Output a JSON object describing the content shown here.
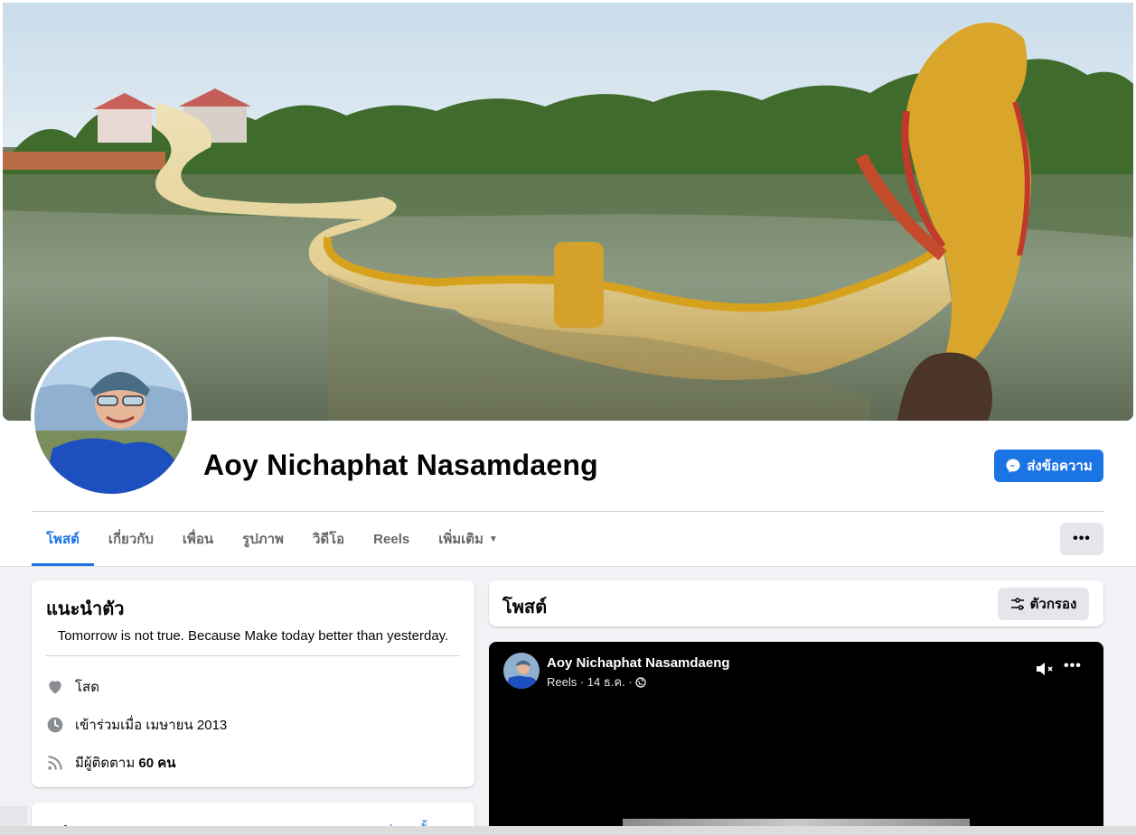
{
  "profile": {
    "name": "Aoy Nichaphat Nasamdaeng",
    "message_button": "ส่งข้อความ",
    "more_button": "•••"
  },
  "tabs": [
    {
      "label": "โพสต์",
      "active": true
    },
    {
      "label": "เกี่ยวกับ",
      "active": false
    },
    {
      "label": "เพื่อน",
      "active": false
    },
    {
      "label": "รูปภาพ",
      "active": false
    },
    {
      "label": "วิดีโอ",
      "active": false
    },
    {
      "label": "Reels",
      "active": false
    },
    {
      "label": "เพิ่มเติม",
      "active": false
    }
  ],
  "intro": {
    "title": "แนะนำตัว",
    "bio": "Tomorrow is not true. Because Make today better than yesterday.",
    "relationship": "โสด",
    "joined": "เข้าร่วมเมื่อ เมษายน 2013",
    "followers_prefix": "มีผู้ติดตาม ",
    "followers_count": "60 คน"
  },
  "photos": {
    "title": "รูปภาพ",
    "see_all": "ดูรูปภาพทั้งหมด"
  },
  "posts": {
    "title": "โพสต์",
    "filter_label": "ตัวกรอง",
    "reel": {
      "author": "Aoy Nichaphat Nasamdaeng",
      "meta": "Reels · 14 ธ.ค. ·",
      "menu": "•••"
    }
  },
  "colors": {
    "accent": "#1b74e4",
    "feed_background": "#f0f2f5",
    "button_grey": "#e4e6eb"
  },
  "icons": {
    "messenger": "messenger-icon",
    "heart": "heart-icon",
    "clock": "clock-icon",
    "rss": "rss-icon",
    "filter": "filter-icon",
    "mute": "mute-icon",
    "globe": "globe-icon"
  }
}
